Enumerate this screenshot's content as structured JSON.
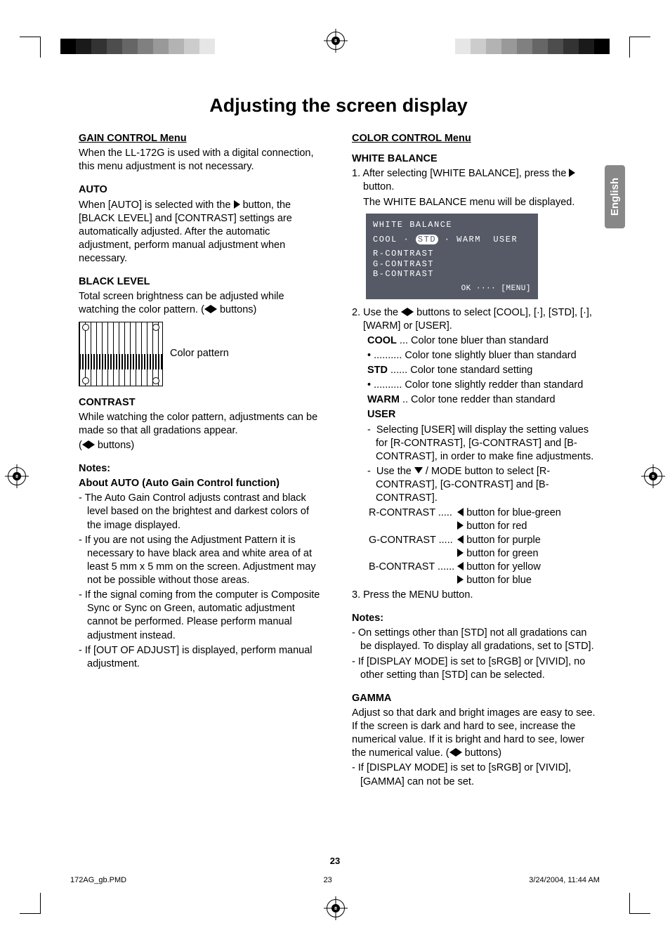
{
  "page_title": "Adjusting the screen display",
  "lang_tab": "English",
  "page_number": "23",
  "footer": {
    "file": "172AG_gb.PMD",
    "page": "23",
    "date": "3/24/2004, 11:44 AM"
  },
  "left": {
    "gain_heading": "GAIN CONTROL Menu",
    "gain_intro": "When the LL-172G is used with a digital connection, this menu adjustment is not necessary.",
    "auto_h": "AUTO",
    "auto_p1a": "When [AUTO] is selected with the ",
    "auto_p1b": " button, the [BLACK LEVEL] and [CONTRAST] settings are automatically adjusted. After the automatic adjustment, perform manual adjustment when necessary.",
    "black_h": "BLACK LEVEL",
    "black_p1a": "Total screen brightness can be adjusted while watching the color pattern. (",
    "black_p1b": " buttons)",
    "color_pattern_label": "Color pattern",
    "contrast_h": "CONTRAST",
    "contrast_p": "While watching the color pattern, adjustments can be made so that all gradations appear.",
    "contrast_btns_a": "(",
    "contrast_btns_b": " buttons)",
    "notes_h": "Notes:",
    "about_h": "About AUTO (Auto Gain Control function)",
    "note1": "The Auto Gain Control adjusts contrast and black level based on the brightest and darkest colors of the image displayed.",
    "note2": "If you are not using the Adjustment Pattern it is necessary to have black area and white area of at least 5 mm x 5 mm on the screen. Adjustment may not be possible without those areas.",
    "note3": "If the signal coming from the computer is Composite Sync or Sync on Green, automatic adjustment cannot be performed. Please perform manual adjustment instead.",
    "note4": "If [OUT OF ADJUST] is displayed, perform manual adjustment."
  },
  "right": {
    "cc_heading": "COLOR CONTROL Menu",
    "wb_h": "WHITE BALANCE",
    "step1a": "After selecting [WHITE BALANCE], press the ",
    "step1b": " button.",
    "step1c": "The WHITE BALANCE menu will be displayed.",
    "osd": {
      "title": "WHITE BALANCE",
      "opts_a": "COOL",
      "opts_dot": "·",
      "opts_sel": "STD",
      "opts_b": "WARM",
      "opts_c": "USER",
      "r": "R-CONTRAST",
      "g": "G-CONTRAST",
      "b": "B-CONTRAST",
      "ok": "OK ···· [MENU]"
    },
    "step2a": "Use the ",
    "step2b": " buttons to select [COOL], [·], [STD], [·], [WARM] or [USER].",
    "cool": "COOL",
    "cool_d": " ... Color tone bluer than standard",
    "dot1": "• .......... Color tone slightly bluer than standard",
    "std": "STD",
    "std_d": " ...... Color tone standard setting",
    "dot2": "• .......... Color tone slightly redder than standard",
    "warm": "WARM",
    "warm_d": " .. Color tone redder than standard",
    "user": "USER",
    "user1": "Selecting [USER] will display the setting values for [R-CONTRAST], [G-CONTRAST] and [B-CONTRAST], in order to make fine adjustments.",
    "user2a": "Use the ",
    "user2b": " / MODE button to select [R-CONTRAST], [G-CONTRAST] and [B-CONTRAST].",
    "rc": "R-CONTRAST .....",
    "rc1": " button for blue-green",
    "rc2": " button for red",
    "gc": "G-CONTRAST .....",
    "gc1": " button for purple",
    "gc2": " button for green",
    "bc": "B-CONTRAST ......",
    "bc1": " button for yellow",
    "bc2": " button for blue",
    "step3": "Press the MENU button.",
    "notes_h": "Notes:",
    "nnote1": "On settings other than [STD] not all gradations can be displayed. To display all gradations, set to [STD].",
    "nnote2": "If [DISPLAY MODE] is set to [sRGB] or [VIVID], no other setting than [STD] can be selected.",
    "gamma_h": "GAMMA",
    "gamma_p_a": "Adjust so that dark and bright images are easy to see. If the screen is dark and hard to see, increase the numerical value. If it is bright and hard to see, lower the numerical value. (",
    "gamma_p_b": " buttons)",
    "gnote": "If [DISPLAY MODE] is set to [sRGB] or [VIVID], [GAMMA] can not be set."
  }
}
